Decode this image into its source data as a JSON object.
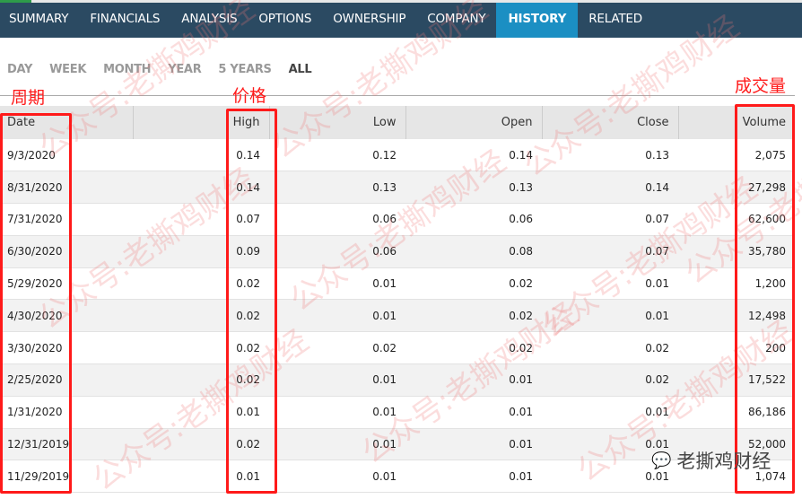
{
  "nav": {
    "tabs": [
      "SUMMARY",
      "FINANCIALS",
      "ANALYSIS",
      "OPTIONS",
      "OWNERSHIP",
      "COMPANY",
      "HISTORY",
      "RELATED"
    ],
    "active": "HISTORY"
  },
  "periods": {
    "options": [
      "DAY",
      "WEEK",
      "MONTH",
      "YEAR",
      "5 YEARS",
      "ALL"
    ],
    "selected": "ALL"
  },
  "annotations": {
    "date": "周期",
    "price": "价格",
    "volume": "成交量"
  },
  "table": {
    "headers": [
      "Date",
      "High",
      "Low",
      "Open",
      "Close",
      "Volume"
    ],
    "rows": [
      [
        "9/3/2020",
        "0.14",
        "0.12",
        "0.14",
        "0.13",
        "2,075"
      ],
      [
        "8/31/2020",
        "0.14",
        "0.13",
        "0.13",
        "0.14",
        "27,298"
      ],
      [
        "7/31/2020",
        "0.07",
        "0.06",
        "0.06",
        "0.07",
        "62,600"
      ],
      [
        "6/30/2020",
        "0.09",
        "0.06",
        "0.08",
        "0.07",
        "35,780"
      ],
      [
        "5/29/2020",
        "0.02",
        "0.01",
        "0.02",
        "0.01",
        "1,200"
      ],
      [
        "4/30/2020",
        "0.02",
        "0.01",
        "0.02",
        "0.01",
        "12,498"
      ],
      [
        "3/30/2020",
        "0.02",
        "0.02",
        "0.02",
        "0.02",
        "200"
      ],
      [
        "2/25/2020",
        "0.02",
        "0.01",
        "0.01",
        "0.02",
        "17,522"
      ],
      [
        "1/31/2020",
        "0.01",
        "0.01",
        "0.01",
        "0.01",
        "86,186"
      ],
      [
        "12/31/2019",
        "0.02",
        "0.01",
        "0.01",
        "0.01",
        "52,000"
      ],
      [
        "11/29/2019",
        "0.01",
        "0.01",
        "0.01",
        "0.01",
        "1,074"
      ]
    ]
  },
  "watermark": "公众号:老撕鸡财经",
  "badge": "老撕鸡财经",
  "colors": {
    "nav_bg": "#2b4a62",
    "active_tab": "#1b8fc3",
    "annotation": "#ff1a1a"
  }
}
